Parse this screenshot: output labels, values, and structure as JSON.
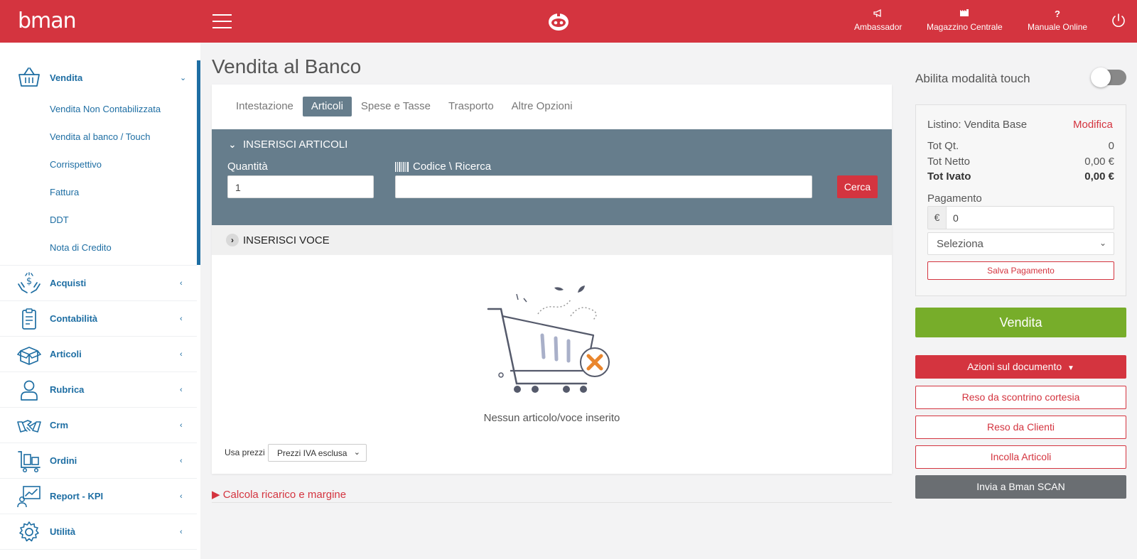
{
  "header": {
    "logo": "bman",
    "nav": [
      {
        "label": "Ambassador",
        "icon": "megaphone-icon"
      },
      {
        "label": "Magazzino Centrale",
        "icon": "warehouse-icon"
      },
      {
        "label": "Manuale Online",
        "icon": "question-icon"
      }
    ]
  },
  "sidebar": {
    "sections": [
      {
        "label": "Vendita",
        "icon": "basket-icon",
        "expanded": true
      },
      {
        "label": "Acquisti",
        "icon": "hands-money-icon"
      },
      {
        "label": "Contabilità",
        "icon": "clipboard-icon"
      },
      {
        "label": "Articoli",
        "icon": "box-icon"
      },
      {
        "label": "Rubrica",
        "icon": "user-icon"
      },
      {
        "label": "Crm",
        "icon": "handshake-icon"
      },
      {
        "label": "Ordini",
        "icon": "luggage-cart-icon"
      },
      {
        "label": "Report - KPI",
        "icon": "chart-screen-icon"
      },
      {
        "label": "Utilità",
        "icon": "gear-icon"
      }
    ],
    "vendita_items": [
      "Vendita Non Contabilizzata",
      "Vendita al banco / Touch",
      "Corrispettivo",
      "Fattura",
      "DDT",
      "Nota di Credito"
    ]
  },
  "main": {
    "title": "Vendita al Banco",
    "tabs": [
      "Intestazione",
      "Articoli",
      "Spese e Tasse",
      "Trasporto",
      "Altre Opzioni"
    ],
    "active_tab": "Articoli",
    "inserisci_articoli": {
      "header": "INSERISCI ARTICOLI",
      "quantita_label": "Quantità",
      "quantita_value": "1",
      "codice_label": "Codice \\ Ricerca",
      "codice_value": "",
      "cerca_label": "Cerca"
    },
    "inserisci_voce": {
      "header": "INSERISCI VOCE"
    },
    "empty_message": "Nessun articolo/voce inserito",
    "usa_prezzi_label": "Usa prezzi",
    "usa_prezzi_value": "Prezzi IVA esclusa",
    "calcola_label": "Calcola ricarico e margine"
  },
  "right": {
    "touch_label": "Abilita modalità touch",
    "touch_enabled": false,
    "listino_label": "Listino: Vendita Base",
    "modifica_label": "Modifica",
    "totals": [
      {
        "label": "Tot Qt.",
        "value": "0",
        "bold": false
      },
      {
        "label": "Tot Netto",
        "value": "0,00 €",
        "bold": false
      },
      {
        "label": "Tot Ivato",
        "value": "0,00 €",
        "bold": true
      }
    ],
    "pagamento_label": "Pagamento",
    "currency_symbol": "€",
    "pagamento_value": "0",
    "pagamento_select": "Seleziona",
    "salva_label": "Salva Pagamento",
    "vendita_label": "Vendita",
    "azioni_label": "Azioni sul documento",
    "reso_scontrino_label": "Reso da scontrino cortesia",
    "reso_clienti_label": "Reso da Clienti",
    "incolla_label": "Incolla Articoli",
    "invia_label": "Invia a Bman SCAN"
  },
  "colors": {
    "brand_red": "#d4343f",
    "sidebar_blue": "#1e6ea3",
    "panel_slate": "#667d8c",
    "vendita_green": "#77ad2a",
    "scan_gray": "#6a6e72"
  }
}
